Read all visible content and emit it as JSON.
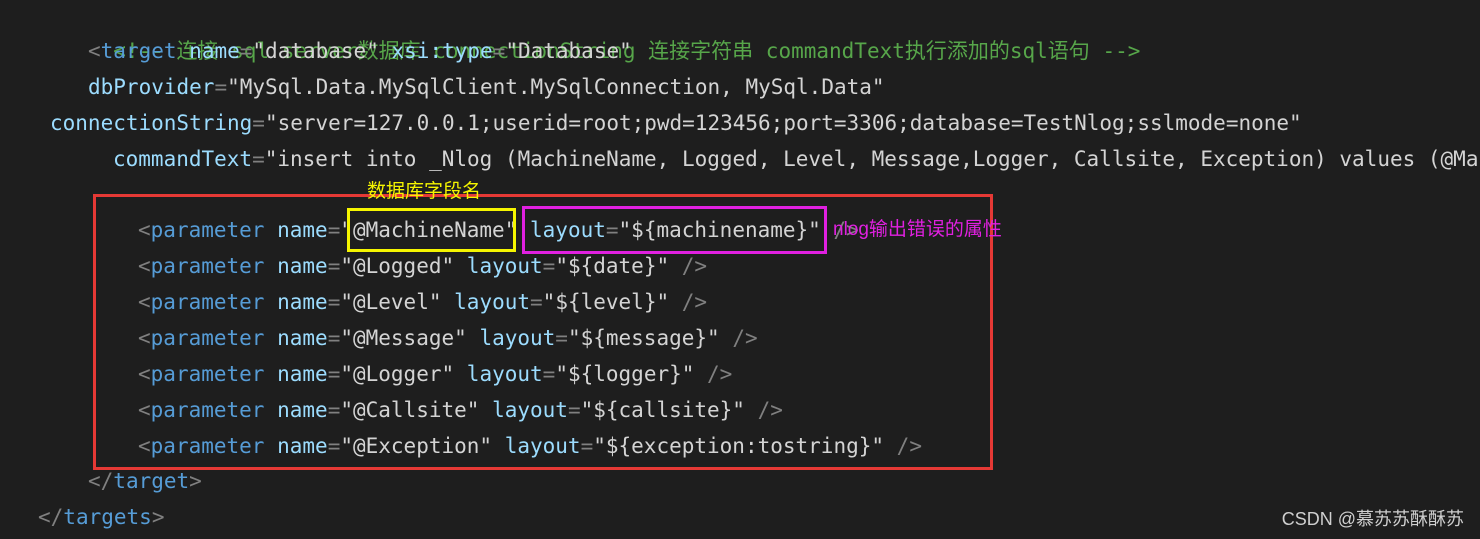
{
  "code": {
    "comment": "<!-- 连接 sql server数据库 connectionString 连接字符串 commandText执行添加的sql语句 -->",
    "target_open": {
      "open_bracket": "<",
      "tag": "target",
      "attr1_name": "name",
      "attr1_eq": "=",
      "attr1_value": "\"database\"",
      "attr2_name": "xsi:type",
      "attr2_eq": "=",
      "attr2_value": "\"Database\""
    },
    "db_provider": {
      "name": "dbProvider",
      "eq": "=",
      "value": "\"MySql.Data.MySqlClient.MySqlConnection, MySql.Data\""
    },
    "connection_string": {
      "name": "connectionString",
      "eq": "=",
      "value": "\"server=127.0.0.1;userid=root;pwd=123456;port=3306;database=TestNlog;sslmode=none\""
    },
    "command_text": {
      "name": "commandText",
      "eq": "=",
      "value": "\"insert into _Nlog (MachineName, Logged, Level, Message,Logger, Callsite, Exception) values (@Mac"
    },
    "parameters": [
      {
        "open": "<",
        "tag": "parameter",
        "name_attr": "name",
        "eq1": "=",
        "name_value": "\"@MachineName\"",
        "layout_attr": "layout",
        "eq2": "=",
        "layout_value": "\"${machinename}\"",
        "close": " />"
      },
      {
        "open": "<",
        "tag": "parameter",
        "name_attr": "name",
        "eq1": "=",
        "name_value": "\"@Logged\"",
        "layout_attr": "layout",
        "eq2": "=",
        "layout_value": "\"${date}\"",
        "close": " />"
      },
      {
        "open": "<",
        "tag": "parameter",
        "name_attr": "name",
        "eq1": "=",
        "name_value": "\"@Level\"",
        "layout_attr": "layout",
        "eq2": "=",
        "layout_value": "\"${level}\"",
        "close": " />"
      },
      {
        "open": "<",
        "tag": "parameter",
        "name_attr": "name",
        "eq1": "=",
        "name_value": "\"@Message\"",
        "layout_attr": "layout",
        "eq2": "=",
        "layout_value": "\"${message}\"",
        "close": " />"
      },
      {
        "open": "<",
        "tag": "parameter",
        "name_attr": "name",
        "eq1": "=",
        "name_value": "\"@Logger\"",
        "layout_attr": "layout",
        "eq2": "=",
        "layout_value": "\"${logger}\"",
        "close": " />"
      },
      {
        "open": "<",
        "tag": "parameter",
        "name_attr": "name",
        "eq1": "=",
        "name_value": "\"@Callsite\"",
        "layout_attr": "layout",
        "eq2": "=",
        "layout_value": "\"${callsite}\"",
        "close": " />"
      },
      {
        "open": "<",
        "tag": "parameter",
        "name_attr": "name",
        "eq1": "=",
        "name_value": "\"@Exception\"",
        "layout_attr": "layout",
        "eq2": "=",
        "layout_value": "\"${exception:tostring}\"",
        "close": " />"
      }
    ],
    "target_close": {
      "open": "</",
      "tag": "target",
      "close": ">"
    },
    "targets_close": {
      "open": "</",
      "tag": "targets",
      "close": ">"
    }
  },
  "annotations": {
    "db_field_name": "数据库字段名",
    "nlog_output_attr": "nlog输出错误的属性"
  },
  "watermark": "CSDN @慕苏苏酥酥苏",
  "colors": {
    "background": "#1e1e1e",
    "comment": "#57a64a",
    "tag": "#569cd6",
    "attribute": "#9cdcfe",
    "highlight_red": "#e53935",
    "highlight_yellow": "#f5f500",
    "highlight_magenta": "#e020e0"
  }
}
